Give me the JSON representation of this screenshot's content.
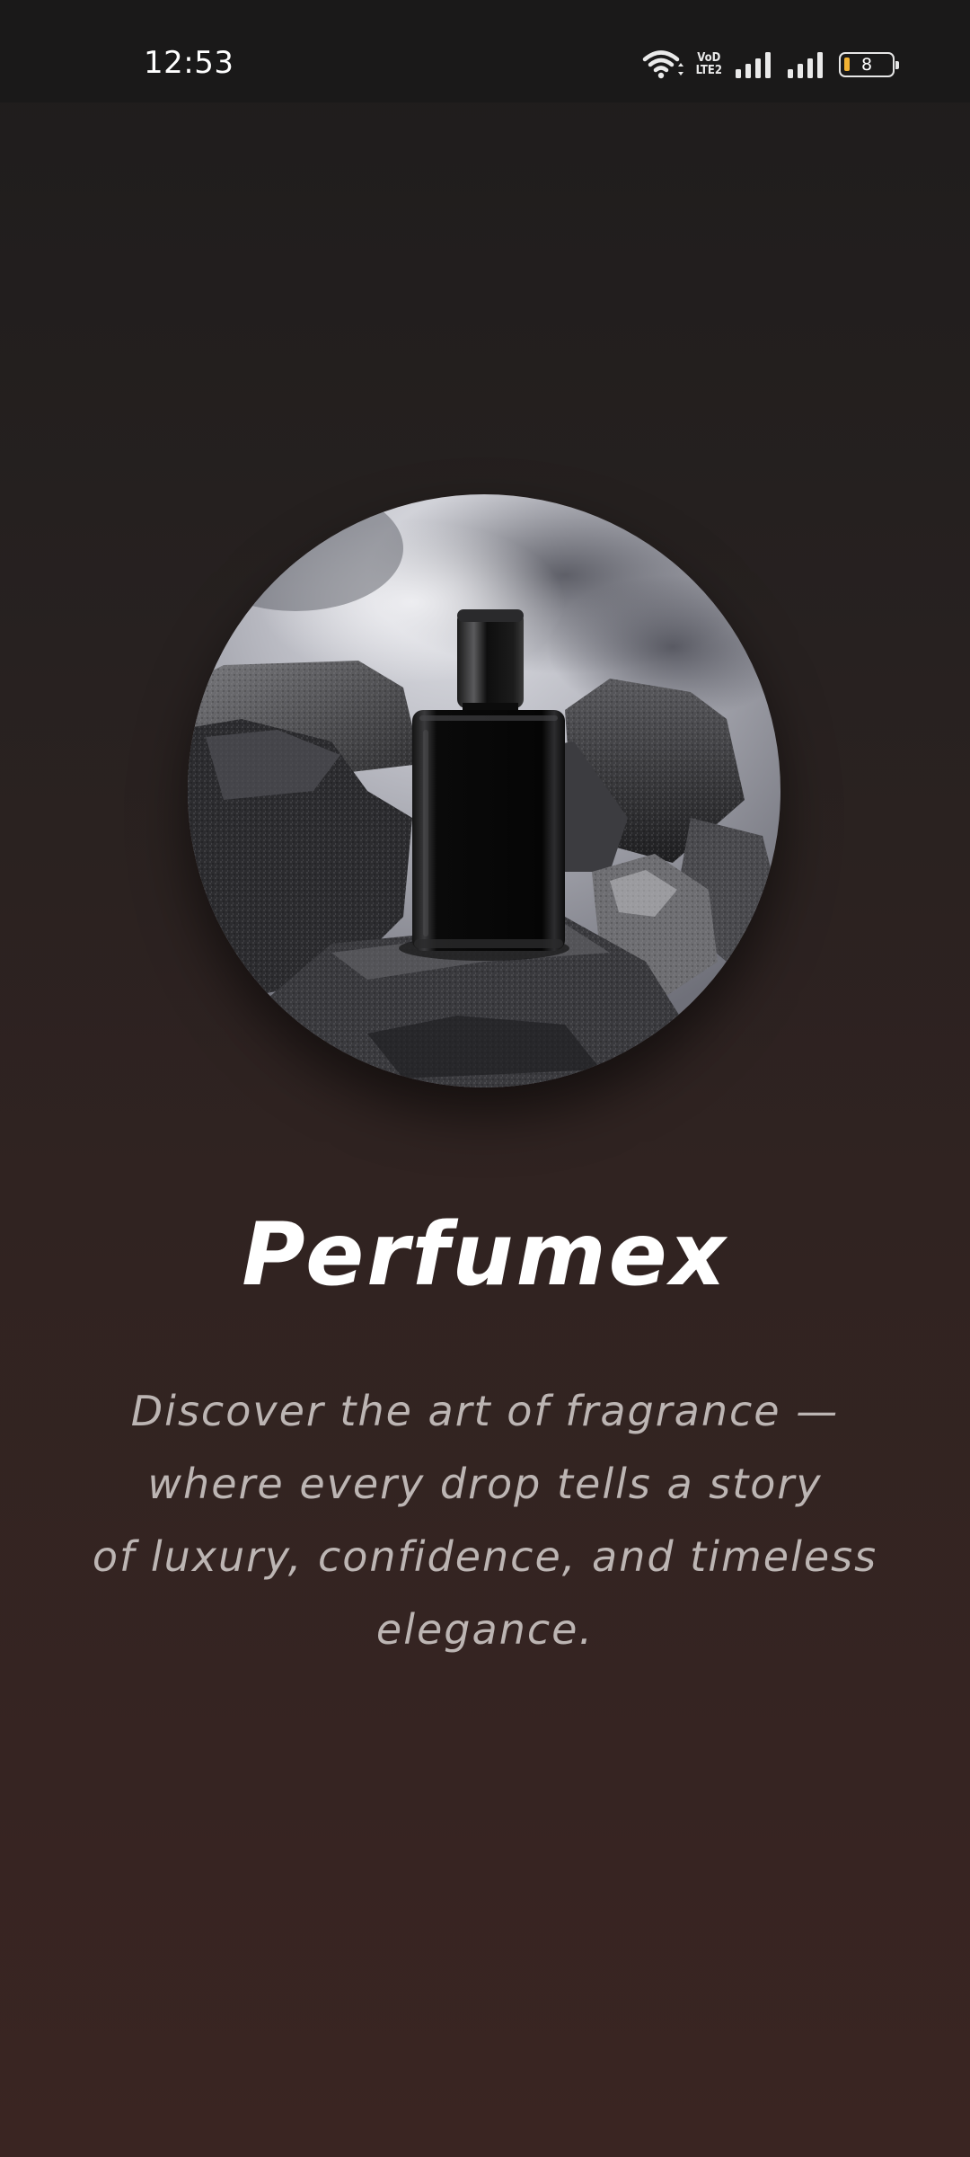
{
  "status_bar": {
    "time": "12:53",
    "volte_line1": "VoD",
    "volte_line2": "LTE2",
    "battery_level": "8",
    "icons": [
      "wifi-icon",
      "volte-icon",
      "signal-icon",
      "signal-icon",
      "battery-icon"
    ],
    "battery_color": "#f2b233"
  },
  "hero": {
    "image": "perfume-bottle-on-rocks"
  },
  "app": {
    "title": "Perfumex",
    "tagline_lines": [
      "Discover the art of fragrance —",
      "where every drop tells a story",
      "of luxury, confidence, and timeless",
      "elegance."
    ]
  },
  "colors": {
    "background_top": "#1e1c1c",
    "background_bottom": "#3a2522",
    "title": "#ffffff",
    "tagline": "#bcb5b3"
  }
}
